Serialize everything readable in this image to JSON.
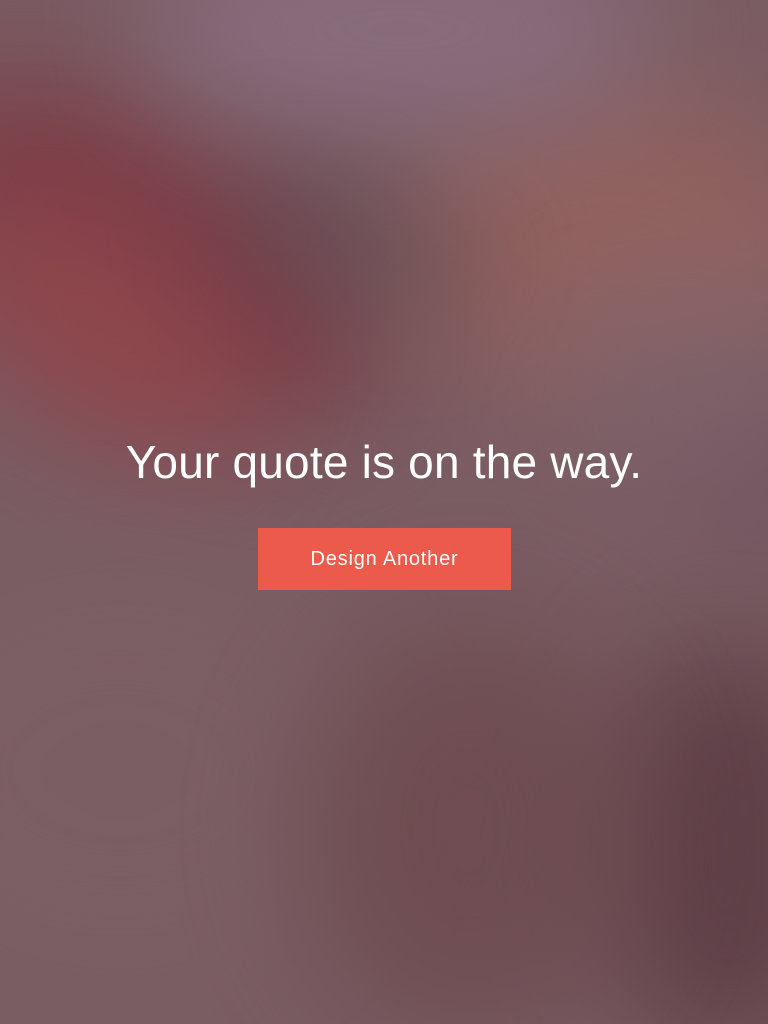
{
  "confirmation": {
    "headline": "Your quote is on the way.",
    "button_label": "Design Another"
  },
  "colors": {
    "button_background": "#eb5a4a",
    "text": "#ffffff"
  }
}
